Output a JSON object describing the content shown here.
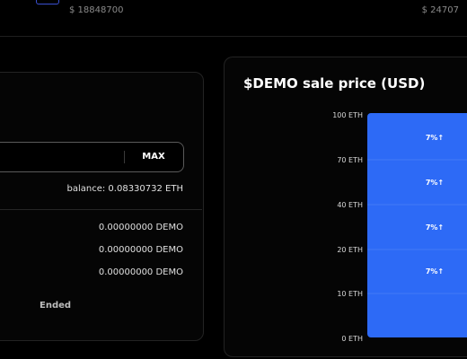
{
  "top": {
    "price_left": "$ 18848700",
    "price_right": "$ 24707"
  },
  "purchase": {
    "max_label": "MAX",
    "balance": "balance: 0.08330732 ETH",
    "demo_rows": [
      "0.00000000 DEMO",
      "0.00000000 DEMO",
      "0.00000000 DEMO"
    ],
    "status": "Ended"
  },
  "colors": {
    "bar": "#2d6af6",
    "panel_border": "#232323",
    "input_border": "#5a5a5a"
  },
  "chart": {
    "title": "$DEMO sale price (USD)"
  },
  "chart_data": {
    "type": "bar",
    "title": "$DEMO sale price (USD)",
    "y_tick_labels": [
      "100 ETH",
      "70 ETH",
      "40 ETH",
      "20 ETH",
      "10 ETH",
      "0 ETH"
    ],
    "bar_labels": [
      "7%↑",
      "7%↑",
      "7%↑",
      "7%↑"
    ],
    "grid": true
  }
}
